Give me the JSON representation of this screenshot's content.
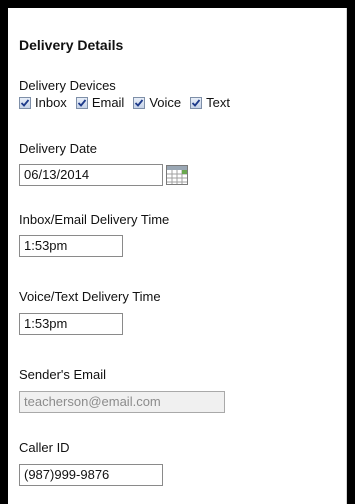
{
  "section": {
    "title": "Delivery Details"
  },
  "devices": {
    "label": "Delivery Devices",
    "options": [
      {
        "label": "Inbox",
        "checked": true
      },
      {
        "label": "Email",
        "checked": true
      },
      {
        "label": "Voice",
        "checked": true
      },
      {
        "label": "Text",
        "checked": true
      }
    ]
  },
  "delivery_date": {
    "label": "Delivery Date",
    "value": "06/13/2014",
    "icon": "calendar-icon"
  },
  "inbox_email_time": {
    "label": "Inbox/Email Delivery Time",
    "value": "1:53pm"
  },
  "voice_text_time": {
    "label": "Voice/Text Delivery Time",
    "value": "1:53pm"
  },
  "sender_email": {
    "label": "Sender's Email",
    "value": "teacherson@email.com"
  },
  "caller_id": {
    "label": "Caller ID",
    "value": "(987)999-9876"
  }
}
